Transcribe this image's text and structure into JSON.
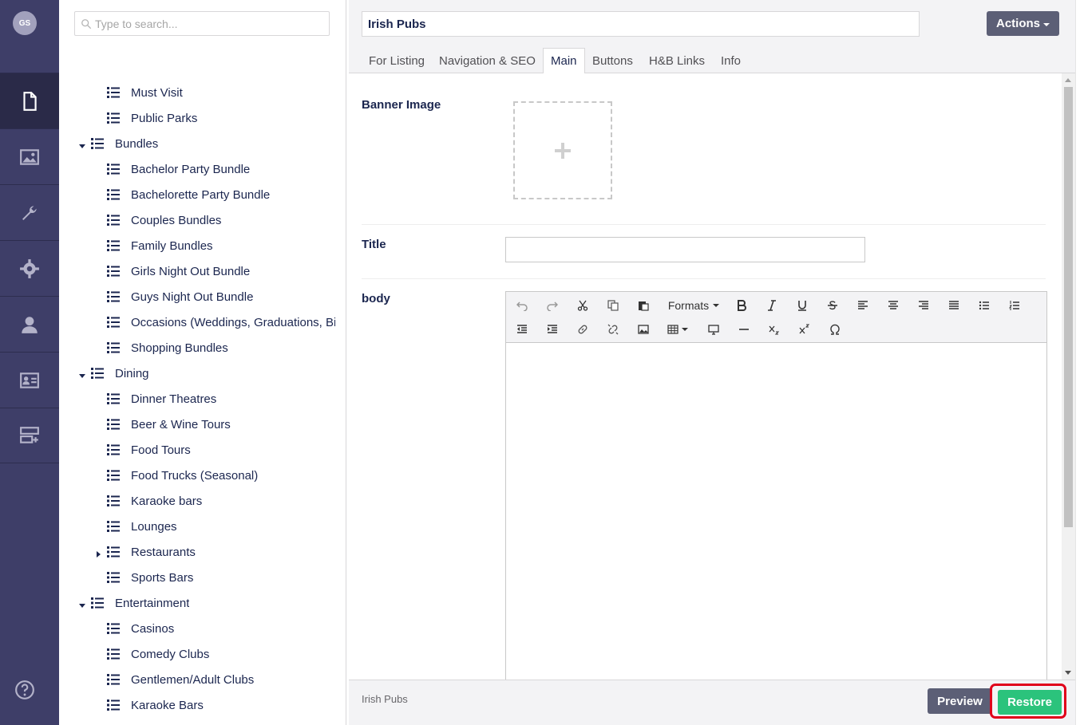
{
  "appbar": {
    "avatar_initials": "GS",
    "items": [
      {
        "name": "content-icon",
        "active": true
      },
      {
        "name": "media-icon"
      },
      {
        "name": "settings-wrench-icon"
      },
      {
        "name": "gear-icon"
      },
      {
        "name": "user-icon"
      },
      {
        "name": "member-card-icon"
      },
      {
        "name": "forms-icon"
      }
    ],
    "help_icon": "help-icon"
  },
  "tree": {
    "search_placeholder": "Type to search...",
    "rows": [
      {
        "label": "Must Visit",
        "level": 2
      },
      {
        "label": "Public Parks",
        "level": 2
      },
      {
        "label": "Bundles",
        "level": 1,
        "expanded": true
      },
      {
        "label": "Bachelor Party Bundle",
        "level": 2
      },
      {
        "label": "Bachelorette Party Bundle",
        "level": 2
      },
      {
        "label": "Couples Bundles",
        "level": 2
      },
      {
        "label": "Family Bundles",
        "level": 2
      },
      {
        "label": "Girls Night Out Bundle",
        "level": 2
      },
      {
        "label": "Guys Night Out Bundle",
        "level": 2
      },
      {
        "label": "Occasions (Weddings, Graduations, Bir",
        "level": 2
      },
      {
        "label": "Shopping Bundles",
        "level": 2
      },
      {
        "label": "Dining",
        "level": 1,
        "expanded": true
      },
      {
        "label": "Dinner Theatres",
        "level": 2
      },
      {
        "label": "Beer & Wine Tours",
        "level": 2
      },
      {
        "label": "Food Tours",
        "level": 2
      },
      {
        "label": "Food Trucks (Seasonal)",
        "level": 2
      },
      {
        "label": "Karaoke bars",
        "level": 2
      },
      {
        "label": "Lounges",
        "level": 2
      },
      {
        "label": "Restaurants",
        "level": 2,
        "collapsed_children": true
      },
      {
        "label": "Sports Bars",
        "level": 2
      },
      {
        "label": "Entertainment",
        "level": 1,
        "expanded": true
      },
      {
        "label": "Casinos",
        "level": 2
      },
      {
        "label": "Comedy Clubs",
        "level": 2
      },
      {
        "label": "Gentlemen/Adult Clubs",
        "level": 2
      },
      {
        "label": "Karaoke Bars",
        "level": 2
      }
    ]
  },
  "editor": {
    "node_name": "Irish Pubs",
    "actions_label": "Actions",
    "tabs": [
      {
        "label": "For Listing"
      },
      {
        "label": "Navigation & SEO"
      },
      {
        "label": "Main",
        "active": true
      },
      {
        "label": "Buttons"
      },
      {
        "label": "H&B Links"
      },
      {
        "label": "Info"
      }
    ],
    "properties": {
      "banner_label": "Banner Image",
      "title_label": "Title",
      "body_label": "body"
    },
    "rte": {
      "formats_label": "Formats"
    },
    "footer": {
      "breadcrumb": "Irish Pubs",
      "preview_label": "Preview",
      "restore_label": "Restore"
    }
  },
  "colors": {
    "appbar_bg": "#3e3e68",
    "primary_btn": "#5c5f76",
    "success_btn": "#2bc37c",
    "highlight_ring": "#e0001a"
  }
}
